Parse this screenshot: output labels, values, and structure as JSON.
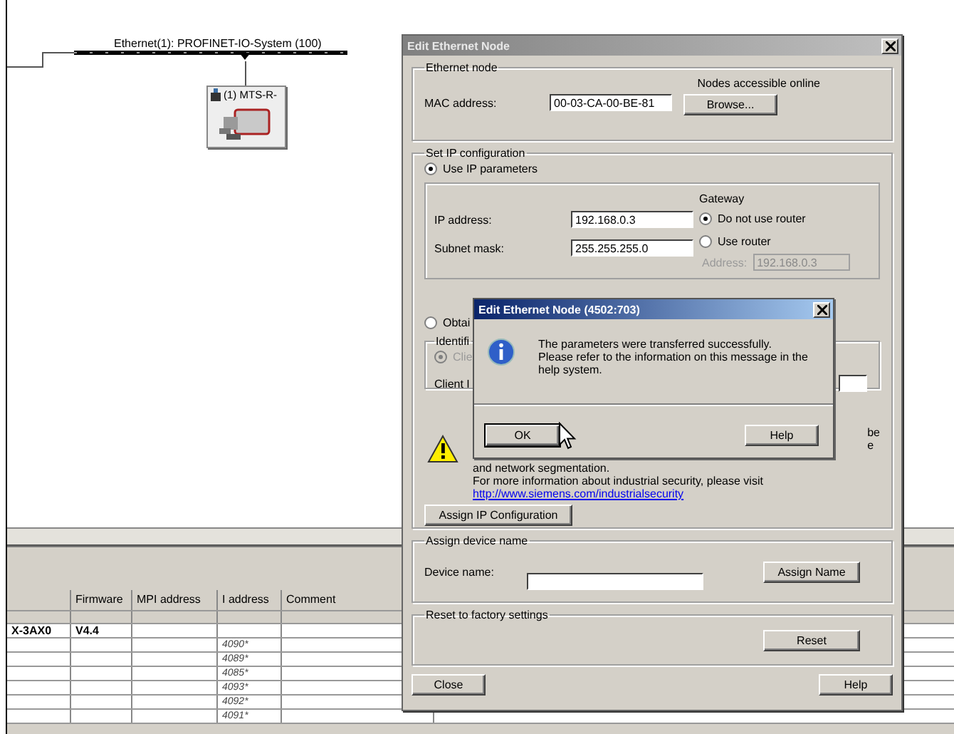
{
  "diagram": {
    "bus_label": "Ethernet(1): PROFINET-IO-System (100)",
    "node": {
      "label": "(1) MTS-R-"
    }
  },
  "table": {
    "columns": [
      "Firmware",
      "MPI address",
      "I address",
      "Comment"
    ],
    "rows": [
      {
        "kind": "module",
        "column_1": "X-3AX0",
        "firmware": "V4.4"
      },
      {
        "kind": "submodule",
        "i_address": "4090*"
      },
      {
        "kind": "submodule",
        "i_address": "4089*"
      },
      {
        "kind": "submodule",
        "i_address": "4085*"
      },
      {
        "kind": "submodule",
        "i_address": "4093*"
      },
      {
        "kind": "submodule",
        "i_address": "4092*"
      },
      {
        "kind": "submodule",
        "i_address": "4091*"
      }
    ]
  },
  "dialog": {
    "title": "Edit Ethernet Node",
    "ethernet_node": {
      "legend": "Ethernet node",
      "online_label": "Nodes accessible online",
      "mac_label": "MAC address:",
      "mac_value": "00-03-CA-00-BE-81",
      "browse_button": "Browse..."
    },
    "ip_config": {
      "legend": "Set IP configuration",
      "use_ip": {
        "label": "Use IP parameters",
        "selected": true
      },
      "ip_label": "IP address:",
      "ip_value": "192.168.0.3",
      "subnet_label": "Subnet mask:",
      "subnet_value": "255.255.255.0",
      "gateway_label": "Gateway",
      "gateway_options": [
        {
          "label": "Do not use router",
          "selected": true
        },
        {
          "label": "Use router",
          "selected": false
        }
      ],
      "router_address_label": "Address:",
      "router_address_value": "192.168.0.3",
      "obtain": {
        "label": "Obtai",
        "selected": false
      },
      "identified_legend": "Identifi",
      "client_option": {
        "label": "Clie",
        "selected": true
      },
      "client_id_label": "Client I",
      "warning_fragments": [
        "be",
        "e"
      ],
      "warning_lines": [
        "and network segmentation.",
        "For more information about industrial security, please visit"
      ],
      "link": "http://www.siemens.com/industrialsecurity",
      "assign_ip_button": "Assign IP Configuration"
    },
    "device_name": {
      "legend": "Assign device name",
      "label": "Device name:",
      "assign_button": "Assign Name"
    },
    "reset": {
      "legend": "Reset to factory settings",
      "button": "Reset"
    },
    "buttons": [
      "Close",
      "Help"
    ]
  },
  "message_box": {
    "title": "Edit Ethernet Node (4502:703)",
    "paragraphs": [
      "The parameters were transferred successfully.",
      "Please refer to the information on this message in the help system."
    ],
    "buttons": [
      "OK",
      "Help"
    ]
  }
}
